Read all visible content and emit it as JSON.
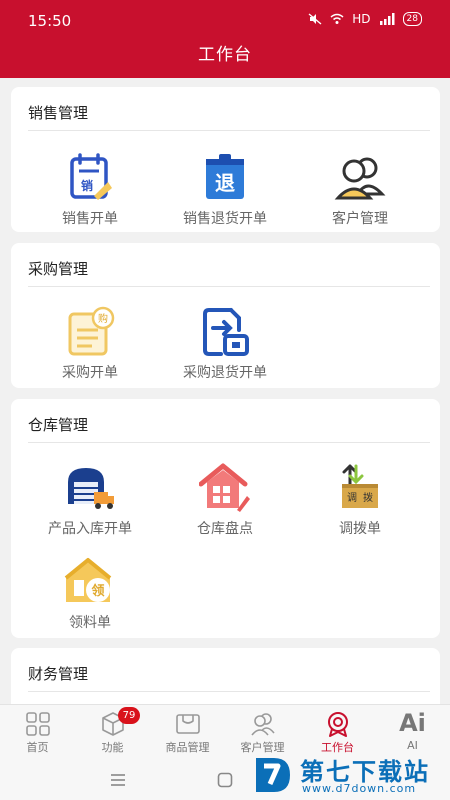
{
  "status_bar": {
    "time": "15:50",
    "network": "HD",
    "battery": "28"
  },
  "header": {
    "title": "工作台"
  },
  "sections": [
    {
      "title": "销售管理",
      "items": [
        {
          "label": "销售开单",
          "icon": "sales-order-icon"
        },
        {
          "label": "销售退货开单",
          "icon": "sales-return-icon"
        },
        {
          "label": "客户管理",
          "icon": "customers-icon"
        }
      ]
    },
    {
      "title": "采购管理",
      "items": [
        {
          "label": "采购开单",
          "icon": "purchase-order-icon"
        },
        {
          "label": "采购退货开单",
          "icon": "purchase-return-icon"
        }
      ]
    },
    {
      "title": "仓库管理",
      "items": [
        {
          "label": "产品入库开单",
          "icon": "inbound-warehouse-icon"
        },
        {
          "label": "仓库盘点",
          "icon": "stocktake-icon"
        },
        {
          "label": "调拨单",
          "icon": "transfer-icon"
        },
        {
          "label": "领料单",
          "icon": "material-requisition-icon"
        }
      ]
    },
    {
      "title": "财务管理",
      "items": []
    }
  ],
  "icon_glyphs": {
    "sales": "销",
    "return": "退",
    "purchase": "购",
    "transfer_a": "调",
    "transfer_b": "拨",
    "requisition": "领"
  },
  "tabs": [
    {
      "label": "首页",
      "icon": "home-grid-icon"
    },
    {
      "label": "功能",
      "icon": "function-cube-icon",
      "badge": "79"
    },
    {
      "label": "商品管理",
      "icon": "goods-box-icon"
    },
    {
      "label": "客户管理",
      "icon": "customer-people-icon"
    },
    {
      "label": "工作台",
      "icon": "workbench-icon",
      "active": true
    },
    {
      "label": "AI",
      "icon": "ai-icon",
      "glyph": "Ai"
    }
  ],
  "watermark": {
    "text": "第七下载站",
    "url": "www.d7down.com"
  },
  "colors": {
    "brand_red": "#c8102e",
    "icon_blue": "#2f55c4",
    "icon_yellow": "#f5c85a",
    "icon_red": "#e85b5b"
  }
}
